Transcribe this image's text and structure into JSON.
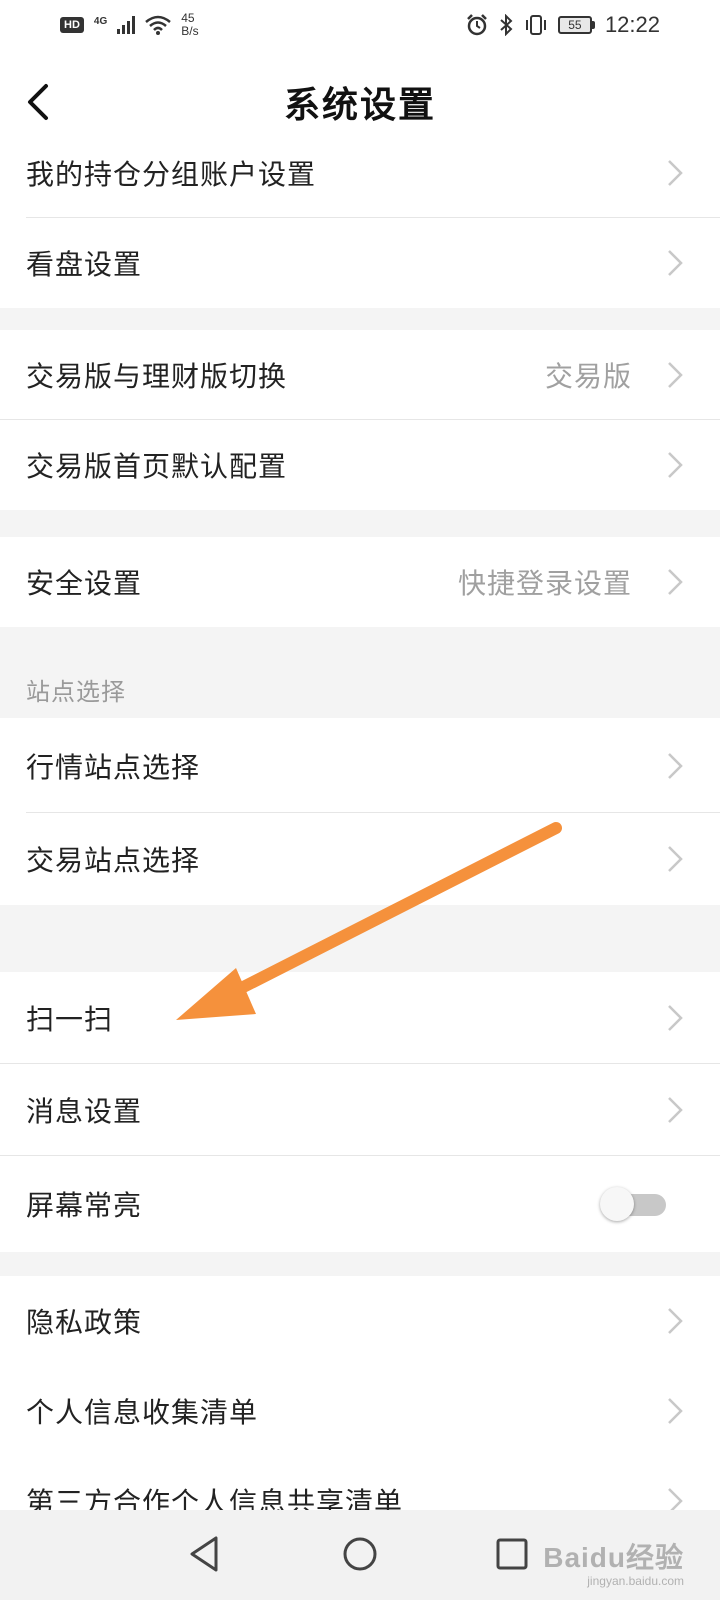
{
  "status_bar": {
    "hd_badge": "HD",
    "network_type": "4G",
    "speed_value": "45",
    "speed_unit": "B/s",
    "battery_level": "55",
    "time": "12:22",
    "icons": [
      "signal-icon",
      "wifi-icon",
      "alarm-icon",
      "bluetooth-icon",
      "vibrate-icon",
      "battery-icon"
    ]
  },
  "header": {
    "title": "系统设置",
    "back_icon": "chevron-left-icon"
  },
  "sections": {
    "account": {
      "items": [
        {
          "label": "我的持仓分组账户设置",
          "value": ""
        },
        {
          "label": "看盘设置",
          "value": ""
        }
      ]
    },
    "trade": {
      "items": [
        {
          "label": "交易版与理财版切换",
          "value": "交易版"
        },
        {
          "label": "交易版首页默认配置",
          "value": ""
        }
      ]
    },
    "security": {
      "items": [
        {
          "label": "安全设置",
          "value": "快捷登录设置"
        }
      ]
    },
    "site": {
      "header": "站点选择",
      "items": [
        {
          "label": "行情站点选择",
          "value": ""
        },
        {
          "label": "交易站点选择",
          "value": ""
        }
      ]
    },
    "misc": {
      "items": [
        {
          "label": "扫一扫",
          "value": ""
        },
        {
          "label": "消息设置",
          "value": ""
        },
        {
          "label": "屏幕常亮",
          "toggle_on": false
        }
      ]
    },
    "privacy": {
      "items": [
        {
          "label": "隐私政策"
        },
        {
          "label": "个人信息收集清单"
        },
        {
          "label": "第三方合作个人信息共享清单"
        }
      ]
    }
  },
  "annotation": {
    "arrow_color": "#f5913c",
    "points_to": "扫一扫"
  },
  "system_nav": {
    "buttons": [
      "back-triangle-icon",
      "home-circle-icon",
      "recents-square-icon"
    ]
  },
  "watermark": {
    "brand": "Baidu经验",
    "url": "jingyan.baidu.com"
  },
  "colors": {
    "background": "#f4f4f4",
    "card": "#ffffff",
    "secondary_text": "#a0a0a0",
    "chevron": "#c8c8c8",
    "toggle_off_track": "#c8c8c8"
  }
}
